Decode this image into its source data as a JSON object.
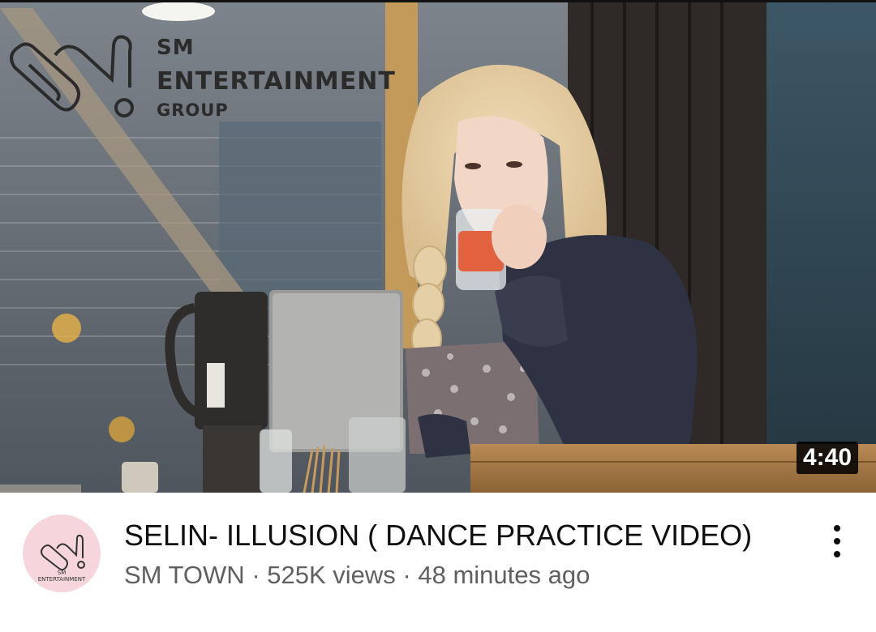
{
  "thumbnail": {
    "duration": "4:40",
    "watermark": {
      "line1": "SM",
      "line2": "ENTERTAINMENT",
      "line3": "GROUP"
    }
  },
  "video": {
    "title": "SELIN- ILLUSION ( DANCE PRACTICE VIDEO)",
    "channel": "SM TOWN",
    "views": "525K views",
    "age": "48 minutes ago",
    "separator": " · "
  },
  "avatar": {
    "line1": "SM",
    "line2": "ENTERTAINMENT",
    "bg_color": "#f6d6dc"
  },
  "icons": {
    "menu": "more-vert-icon"
  }
}
